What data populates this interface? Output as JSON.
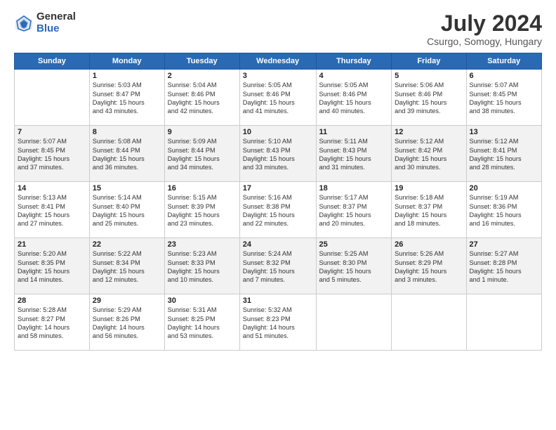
{
  "header": {
    "logo_general": "General",
    "logo_blue": "Blue",
    "title": "July 2024",
    "subtitle": "Csurgo, Somogy, Hungary"
  },
  "calendar": {
    "headers": [
      "Sunday",
      "Monday",
      "Tuesday",
      "Wednesday",
      "Thursday",
      "Friday",
      "Saturday"
    ],
    "weeks": [
      [
        {
          "day": "",
          "info": ""
        },
        {
          "day": "1",
          "info": "Sunrise: 5:03 AM\nSunset: 8:47 PM\nDaylight: 15 hours\nand 43 minutes."
        },
        {
          "day": "2",
          "info": "Sunrise: 5:04 AM\nSunset: 8:46 PM\nDaylight: 15 hours\nand 42 minutes."
        },
        {
          "day": "3",
          "info": "Sunrise: 5:05 AM\nSunset: 8:46 PM\nDaylight: 15 hours\nand 41 minutes."
        },
        {
          "day": "4",
          "info": "Sunrise: 5:05 AM\nSunset: 8:46 PM\nDaylight: 15 hours\nand 40 minutes."
        },
        {
          "day": "5",
          "info": "Sunrise: 5:06 AM\nSunset: 8:46 PM\nDaylight: 15 hours\nand 39 minutes."
        },
        {
          "day": "6",
          "info": "Sunrise: 5:07 AM\nSunset: 8:45 PM\nDaylight: 15 hours\nand 38 minutes."
        }
      ],
      [
        {
          "day": "7",
          "info": "Sunrise: 5:07 AM\nSunset: 8:45 PM\nDaylight: 15 hours\nand 37 minutes."
        },
        {
          "day": "8",
          "info": "Sunrise: 5:08 AM\nSunset: 8:44 PM\nDaylight: 15 hours\nand 36 minutes."
        },
        {
          "day": "9",
          "info": "Sunrise: 5:09 AM\nSunset: 8:44 PM\nDaylight: 15 hours\nand 34 minutes."
        },
        {
          "day": "10",
          "info": "Sunrise: 5:10 AM\nSunset: 8:43 PM\nDaylight: 15 hours\nand 33 minutes."
        },
        {
          "day": "11",
          "info": "Sunrise: 5:11 AM\nSunset: 8:43 PM\nDaylight: 15 hours\nand 31 minutes."
        },
        {
          "day": "12",
          "info": "Sunrise: 5:12 AM\nSunset: 8:42 PM\nDaylight: 15 hours\nand 30 minutes."
        },
        {
          "day": "13",
          "info": "Sunrise: 5:12 AM\nSunset: 8:41 PM\nDaylight: 15 hours\nand 28 minutes."
        }
      ],
      [
        {
          "day": "14",
          "info": "Sunrise: 5:13 AM\nSunset: 8:41 PM\nDaylight: 15 hours\nand 27 minutes."
        },
        {
          "day": "15",
          "info": "Sunrise: 5:14 AM\nSunset: 8:40 PM\nDaylight: 15 hours\nand 25 minutes."
        },
        {
          "day": "16",
          "info": "Sunrise: 5:15 AM\nSunset: 8:39 PM\nDaylight: 15 hours\nand 23 minutes."
        },
        {
          "day": "17",
          "info": "Sunrise: 5:16 AM\nSunset: 8:38 PM\nDaylight: 15 hours\nand 22 minutes."
        },
        {
          "day": "18",
          "info": "Sunrise: 5:17 AM\nSunset: 8:37 PM\nDaylight: 15 hours\nand 20 minutes."
        },
        {
          "day": "19",
          "info": "Sunrise: 5:18 AM\nSunset: 8:37 PM\nDaylight: 15 hours\nand 18 minutes."
        },
        {
          "day": "20",
          "info": "Sunrise: 5:19 AM\nSunset: 8:36 PM\nDaylight: 15 hours\nand 16 minutes."
        }
      ],
      [
        {
          "day": "21",
          "info": "Sunrise: 5:20 AM\nSunset: 8:35 PM\nDaylight: 15 hours\nand 14 minutes."
        },
        {
          "day": "22",
          "info": "Sunrise: 5:22 AM\nSunset: 8:34 PM\nDaylight: 15 hours\nand 12 minutes."
        },
        {
          "day": "23",
          "info": "Sunrise: 5:23 AM\nSunset: 8:33 PM\nDaylight: 15 hours\nand 10 minutes."
        },
        {
          "day": "24",
          "info": "Sunrise: 5:24 AM\nSunset: 8:32 PM\nDaylight: 15 hours\nand 7 minutes."
        },
        {
          "day": "25",
          "info": "Sunrise: 5:25 AM\nSunset: 8:30 PM\nDaylight: 15 hours\nand 5 minutes."
        },
        {
          "day": "26",
          "info": "Sunrise: 5:26 AM\nSunset: 8:29 PM\nDaylight: 15 hours\nand 3 minutes."
        },
        {
          "day": "27",
          "info": "Sunrise: 5:27 AM\nSunset: 8:28 PM\nDaylight: 15 hours\nand 1 minute."
        }
      ],
      [
        {
          "day": "28",
          "info": "Sunrise: 5:28 AM\nSunset: 8:27 PM\nDaylight: 14 hours\nand 58 minutes."
        },
        {
          "day": "29",
          "info": "Sunrise: 5:29 AM\nSunset: 8:26 PM\nDaylight: 14 hours\nand 56 minutes."
        },
        {
          "day": "30",
          "info": "Sunrise: 5:31 AM\nSunset: 8:25 PM\nDaylight: 14 hours\nand 53 minutes."
        },
        {
          "day": "31",
          "info": "Sunrise: 5:32 AM\nSunset: 8:23 PM\nDaylight: 14 hours\nand 51 minutes."
        },
        {
          "day": "",
          "info": ""
        },
        {
          "day": "",
          "info": ""
        },
        {
          "day": "",
          "info": ""
        }
      ]
    ]
  }
}
